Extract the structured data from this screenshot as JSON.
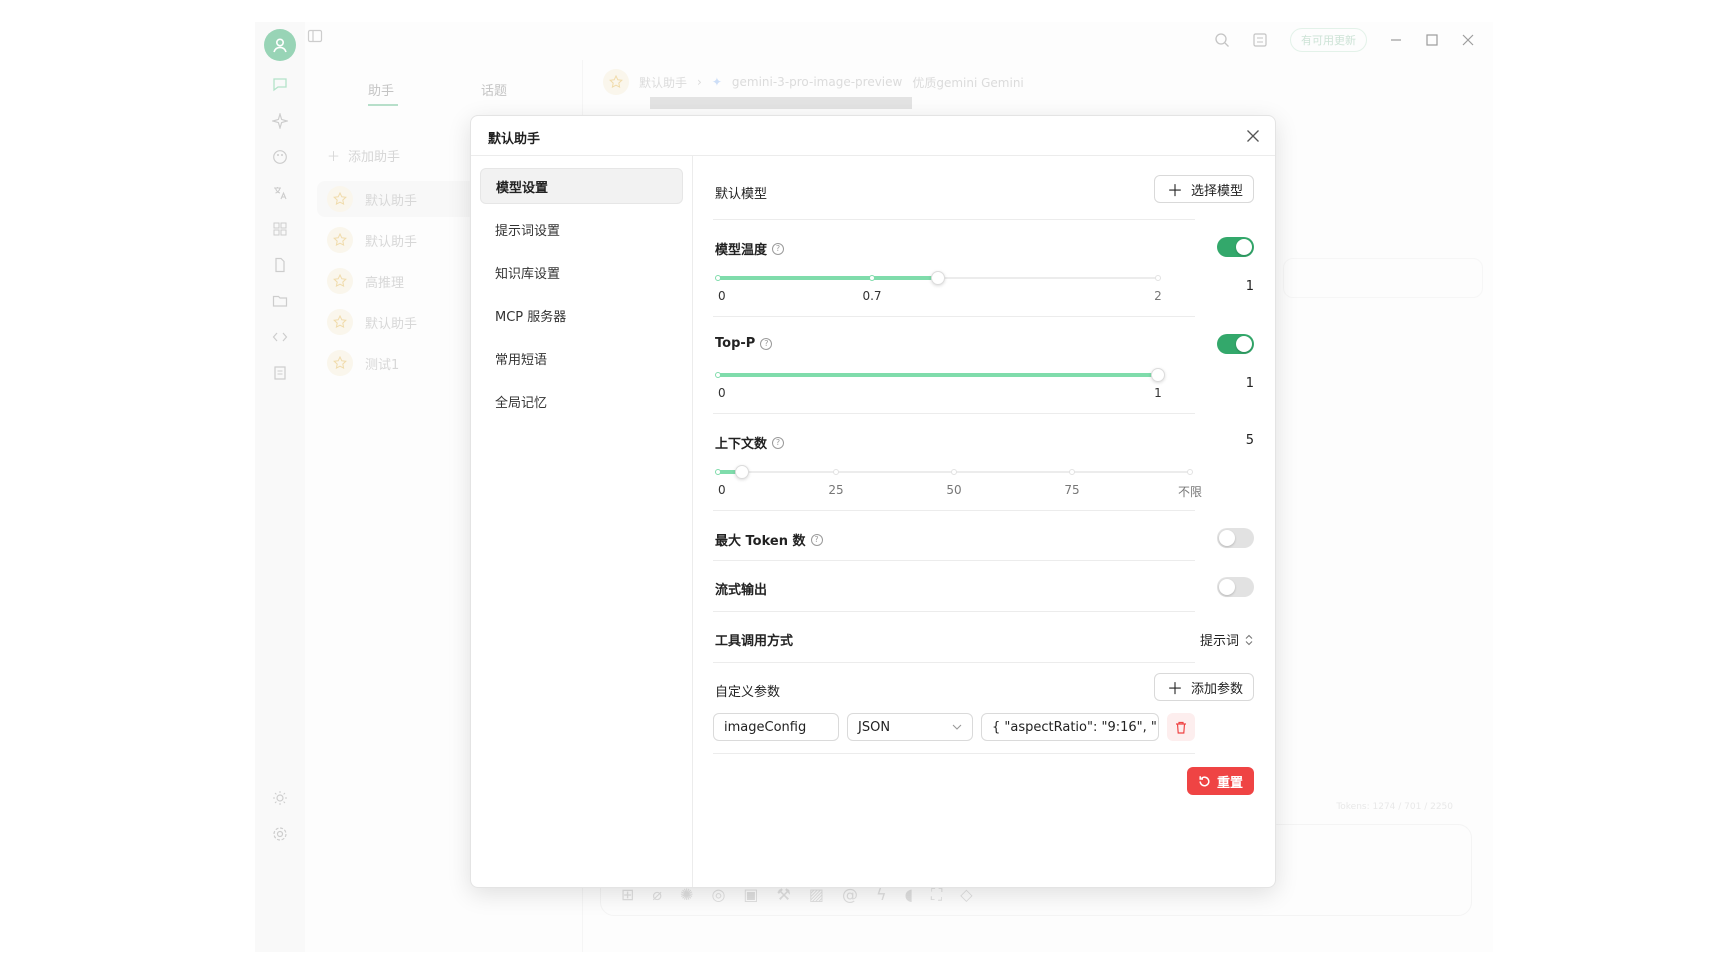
{
  "app": {
    "update_pill": "有可用更新",
    "assistants_tab": "助手",
    "topics_tab": "话题",
    "add_assistant": "添加助手",
    "assistant_list": [
      "默认助手",
      "默认助手",
      "高推理",
      "默认助手",
      "测试1"
    ],
    "breadcrumb_assistant": "默认助手",
    "breadcrumb_model": "gemini-3-pro-image-preview",
    "breadcrumb_provider": "优质gemini Gemini",
    "token_info": "Tokens: 1274 / 701 / 2250"
  },
  "modal": {
    "title": "默认助手",
    "nav": [
      "模型设置",
      "提示词设置",
      "知识库设置",
      "MCP 服务器",
      "常用短语",
      "全局记忆"
    ],
    "default_model": {
      "label": "默认模型",
      "button": "选择模型"
    },
    "temperature": {
      "label": "模型温度",
      "enabled": true,
      "value": "1",
      "min": 0,
      "max": 2,
      "current": 1,
      "marks": [
        {
          "value": 0,
          "label": "0"
        },
        {
          "value": 0.7,
          "label": "0.7"
        },
        {
          "value": 2,
          "label": "2"
        }
      ]
    },
    "top_p": {
      "label": "Top-P",
      "enabled": true,
      "value": "1",
      "min": 0,
      "max": 1,
      "current": 1,
      "marks": [
        {
          "value": 0,
          "label": "0"
        },
        {
          "value": 1,
          "label": "1"
        }
      ]
    },
    "context": {
      "label": "上下文数",
      "value": "5",
      "min": 0,
      "max": 100,
      "current": 5,
      "marks": [
        {
          "value": 0,
          "label": "0"
        },
        {
          "value": 25,
          "label": "25"
        },
        {
          "value": 50,
          "label": "50"
        },
        {
          "value": 75,
          "label": "75"
        },
        {
          "value": 100,
          "label": "不限"
        }
      ]
    },
    "max_tokens": {
      "label": "最大 Token 数",
      "enabled": false
    },
    "stream_output": {
      "label": "流式输出",
      "enabled": false
    },
    "tool_call": {
      "label": "工具调用方式",
      "value": "提示词"
    },
    "custom_params": {
      "label": "自定义参数",
      "add_button": "添加参数",
      "param_name": "imageConfig",
      "param_type": "JSON",
      "param_value": "{    \"aspectRatio\": \"9:16\",    \""
    },
    "reset_button": "重置"
  },
  "colors": {
    "accent": "#33a86b",
    "slider_fill": "#7fdcab",
    "danger": "#ef4444"
  }
}
